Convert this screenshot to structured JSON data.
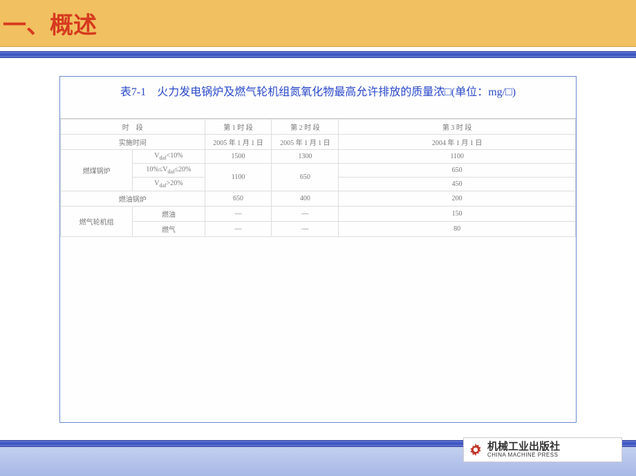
{
  "title": "一、概述",
  "table": {
    "caption": "表7-1　火力发电锅炉及燃气轮机组氮氧化物最高允许排放的质量浓□(单位：mg/□)",
    "head": {
      "period_label": "时　段",
      "p1": "第 1 时 段",
      "p2": "第 2 时 段",
      "p3": "第 3 时 段",
      "impl_label": "实施时间",
      "impl_p1": "2005 年 1 月 1 日",
      "impl_p2": "2005 年 1 月 1 日",
      "impl_p3": "2004 年 1 月 1 日"
    },
    "rows": {
      "coal_label": "燃煤锅炉",
      "coal_r1_cond": "Vdaf<10%",
      "coal_r1_p1": "1500",
      "coal_r1_p2": "1300",
      "coal_r1_p3": "1100",
      "coal_r2_cond": "10%≤Vdaf≤20%",
      "coal_r23_p1": "1100",
      "coal_r23_p2": "650",
      "coal_r2_p3": "650",
      "coal_r3_cond": "Vdaf>20%",
      "coal_r3_p3": "450",
      "oil_label": "燃油锅炉",
      "oil_p1": "650",
      "oil_p2": "400",
      "oil_p3": "200",
      "gasturbine_label": "燃气轮机组",
      "gt_oil_label": "燃油",
      "gt_oil_p1": "—",
      "gt_oil_p2": "—",
      "gt_oil_p3": "150",
      "gt_gas_label": "燃气",
      "gt_gas_p1": "—",
      "gt_gas_p2": "—",
      "gt_gas_p3": "80"
    }
  },
  "publisher": {
    "cn": "机械工业出版社",
    "en": "CHINA MACHINE PRESS"
  }
}
